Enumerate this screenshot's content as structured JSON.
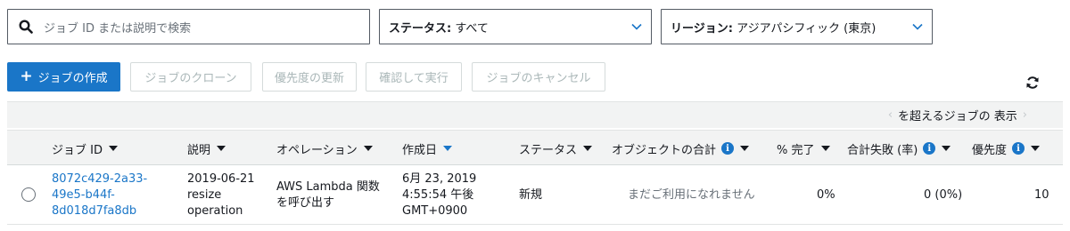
{
  "search": {
    "placeholder": "ジョブ ID または説明で検索"
  },
  "status_filter": {
    "label": "ステータス:",
    "value": "すべて"
  },
  "region_filter": {
    "label": "リージョン:",
    "value": "アジアパシフィック (東京)"
  },
  "toolbar": {
    "create_label": "ジョブの作成",
    "clone_label": "ジョブのクローン",
    "priority_label": "優先度の更新",
    "confirm_label": "確認して実行",
    "cancel_label": "ジョブのキャンセル"
  },
  "pager": {
    "text": "を超えるジョブの 表示"
  },
  "table": {
    "columns": [
      "ジョブ ID",
      "説明",
      "オペレーション",
      "作成日",
      "ステータス",
      "オブジェクトの合計",
      "% 完了",
      "合計失敗 (率)",
      "優先度"
    ],
    "rows": [
      {
        "job_id": [
          "8072c429-2a33-",
          "49e5-b44f-",
          "8d018d7fa8db"
        ],
        "description": [
          "2019-06-21",
          "resize",
          "operation"
        ],
        "operation": [
          "AWS Lambda 関数",
          "を呼び出す"
        ],
        "created": [
          "6月 23, 2019",
          "4:55:54 午後",
          "GMT+0900"
        ],
        "status": "新規",
        "total_objects": "まだご利用になれません",
        "percent_complete": "0%",
        "total_failed": "0 (0%)",
        "priority": "10"
      }
    ]
  },
  "colors": {
    "accent": "#1a76c8",
    "header_bg": "#f2f3f3",
    "disabled_text": "#aab7b8"
  },
  "icons": [
    "search-icon",
    "chevron-down-icon",
    "plus-icon",
    "refresh-icon",
    "info-icon",
    "sort-caret-icon"
  ]
}
